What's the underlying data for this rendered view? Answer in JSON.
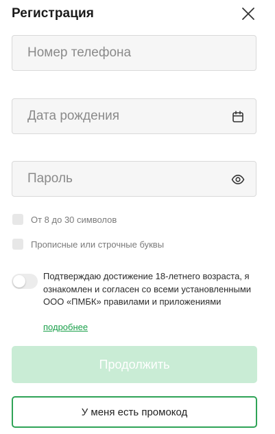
{
  "header": {
    "title": "Регистрация",
    "close_icon": "close-icon"
  },
  "form": {
    "phone": {
      "value": "",
      "placeholder": "Номер телефона"
    },
    "birth_date": {
      "value": "",
      "placeholder": "Дата рождения",
      "icon": "calendar-icon"
    },
    "password": {
      "value": "",
      "placeholder": "Пароль",
      "icon": "eye-icon"
    }
  },
  "password_rules": [
    {
      "label": "От 8 до 30 символов",
      "checked": false
    },
    {
      "label": "Прописные или строчные буквы",
      "checked": false
    }
  ],
  "consent": {
    "text": "Подтверждаю достижение 18-летнего возраста, я ознакомлен и согласен со всеми установленными ООО «ПМБК» правилами и приложениями",
    "link_label": "подробнее",
    "toggled": false
  },
  "buttons": {
    "continue_label": "Продолжить",
    "promo_label": "У меня есть промокод"
  },
  "colors": {
    "accent": "#2ea356",
    "link": "#1aa04a",
    "continue_disabled_bg": "#c9ecd5",
    "field_bg": "#f6f6f6",
    "field_border": "#d9d9d9"
  }
}
